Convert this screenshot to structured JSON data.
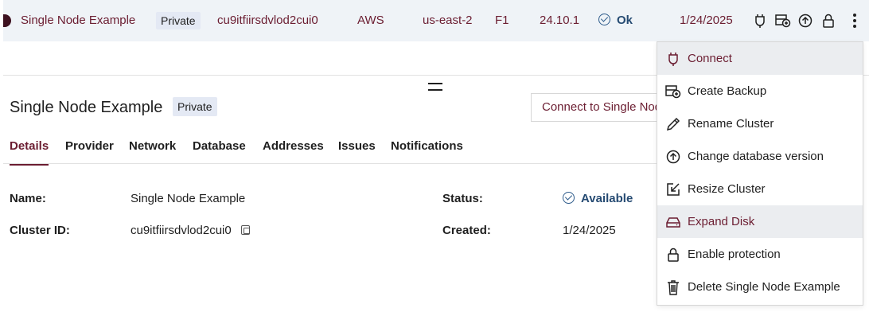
{
  "row": {
    "name": "Single Node Example",
    "visibility": "Private",
    "cluster_id": "cu9itfiirsdvlod2cui0",
    "provider": "AWS",
    "region": "us-east-2",
    "tier": "F1",
    "version": "24.10.1",
    "status": "Ok",
    "created": "1/24/2025"
  },
  "details": {
    "title": "Single Node Example",
    "badge": "Private",
    "connect_button": "Connect to Single Node Example",
    "tabs": [
      "Details",
      "Provider",
      "Network",
      "Database",
      "Addresses",
      "Issues",
      "Notifications"
    ],
    "active_tab": "Details",
    "fields": {
      "name_label": "Name:",
      "name_value": "Single Node Example",
      "cluster_id_label": "Cluster ID:",
      "cluster_id_value": "cu9itfiirsdvlod2cui0",
      "status_label": "Status:",
      "status_value": "Available",
      "created_label": "Created:",
      "created_value": "1/24/2025"
    }
  },
  "menu": {
    "items": [
      {
        "label": "Connect",
        "icon": "connect-icon",
        "highlighted": true
      },
      {
        "label": "Create Backup",
        "icon": "backup-icon",
        "highlighted": false
      },
      {
        "label": "Rename Cluster",
        "icon": "pencil-icon",
        "highlighted": false
      },
      {
        "label": "Change database version",
        "icon": "upgrade-icon",
        "highlighted": false
      },
      {
        "label": "Resize Cluster",
        "icon": "resize-icon",
        "highlighted": false
      },
      {
        "label": "Expand Disk",
        "icon": "disk-icon",
        "highlighted": true
      },
      {
        "label": "Enable protection",
        "icon": "lock-icon",
        "highlighted": false
      },
      {
        "label": "Delete Single Node Example",
        "icon": "trash-icon",
        "highlighted": false
      }
    ]
  },
  "colors": {
    "accent": "#6b1d31",
    "row_background": "#eff3f7",
    "status_ok": "#254a72",
    "badge_background": "#e4e9f4",
    "menu_highlight": "#ebedf0"
  }
}
